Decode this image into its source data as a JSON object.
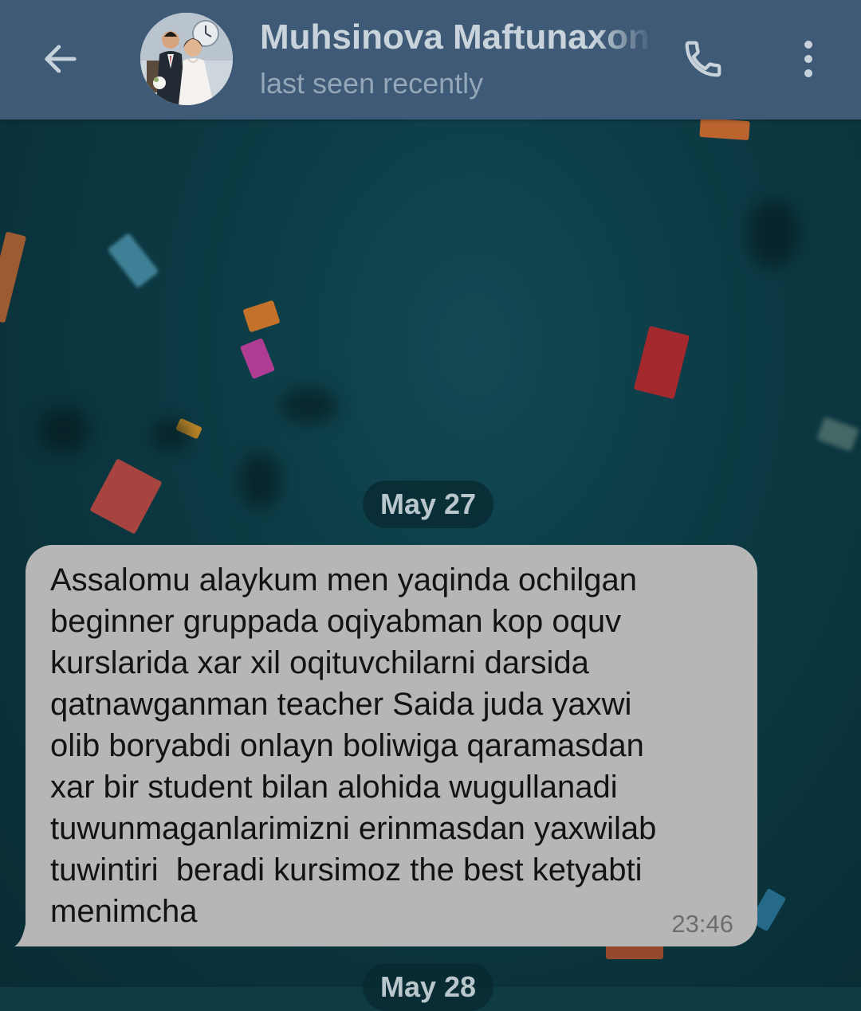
{
  "header": {
    "contact_name": "Muhsinova Maftunaxon",
    "status": "last seen recently",
    "back_icon": "arrow-left-icon",
    "call_icon": "phone-icon",
    "menu_icon": "more-vertical-icon"
  },
  "chat": {
    "date_separators": [
      "May 27",
      "May 28"
    ],
    "messages": [
      {
        "text": "Assalomu alaykum men yaqinda ochilgan\nbeginner gruppada oqiyabman kop oquv\nkurslarida xar xil oqituvchilarni darsida\nqatnawganman teacher Saida juda yaxwi\nolib boryabdi onlayn boliwiga qaramasdan\nxar bir student bilan alohida wugullanadi\ntuwunmaganlarimizni erinmasdan yaxwilab\ntuwintiri  beradi kursimoz the best ketyabti\nmenimcha",
        "time": "23:46"
      }
    ]
  },
  "colors": {
    "header_bg": "#3e5a76",
    "bubble_bg": "#b6b6b6",
    "chat_bg": "#0f4652"
  }
}
